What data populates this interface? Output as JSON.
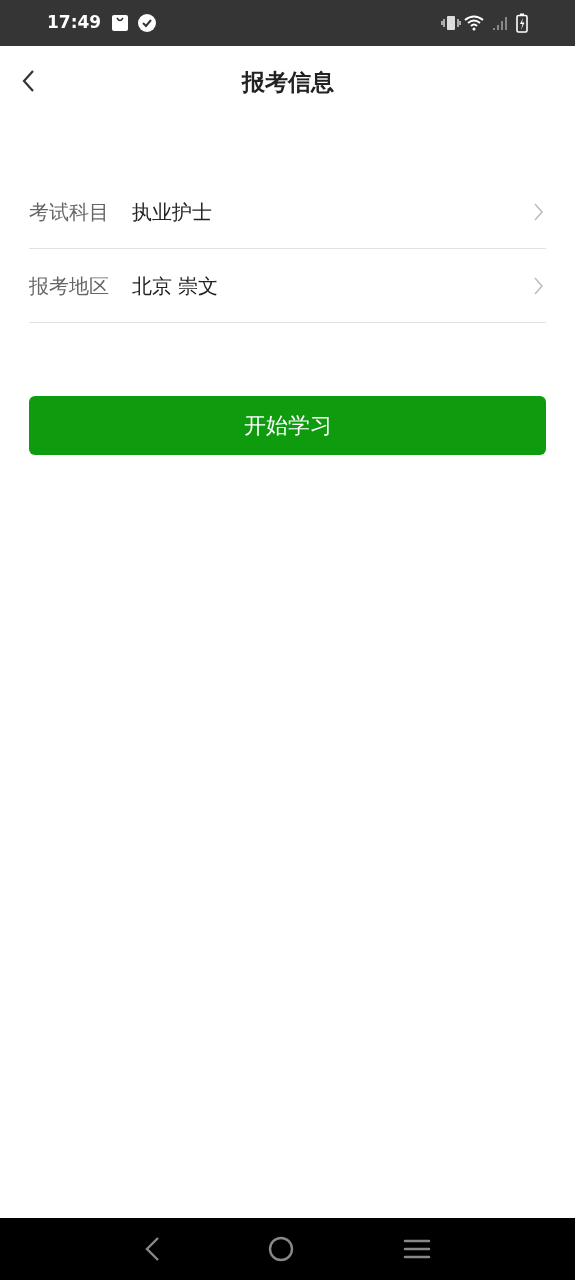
{
  "status_bar": {
    "time": "17:49"
  },
  "header": {
    "title": "报考信息"
  },
  "fields": [
    {
      "label": "考试科目",
      "value": "执业护士"
    },
    {
      "label": "报考地区",
      "value": "北京 崇文"
    }
  ],
  "primary_button": "开始学习"
}
